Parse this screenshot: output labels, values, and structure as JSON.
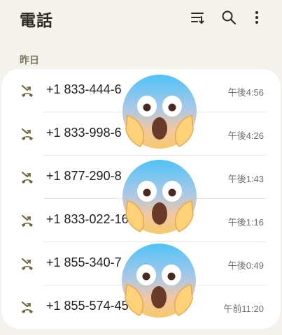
{
  "app": {
    "title": "電話"
  },
  "toolbar": {
    "icons": [
      "filter-icon",
      "search-icon",
      "more-vert-icon"
    ]
  },
  "section": {
    "label": "昨日"
  },
  "calls": [
    {
      "number": "+1 833-444-6",
      "time": "午後4:56",
      "icon": "missed-call-icon"
    },
    {
      "number": "+1 833-998-6",
      "time": "午後4:26",
      "icon": "missed-call-icon"
    },
    {
      "number": "+1 877-290-8",
      "time": "午後1:43",
      "icon": "missed-call-icon"
    },
    {
      "number": "+1 833-022-16",
      "time": "午後1:16",
      "icon": "missed-call-icon"
    },
    {
      "number": "+1 855-340-7",
      "time": "午後0:49",
      "icon": "missed-call-icon"
    },
    {
      "number": "+1 855-574-45",
      "time": "午前11:20",
      "icon": "missed-call-icon"
    }
  ],
  "overlays": [
    "screaming-emoji",
    "screaming-emoji",
    "screaming-emoji"
  ],
  "colors": {
    "background": "#f4f2ec",
    "card": "#ffffff",
    "icon": "#6b6336",
    "text": "#1e1e1e"
  }
}
